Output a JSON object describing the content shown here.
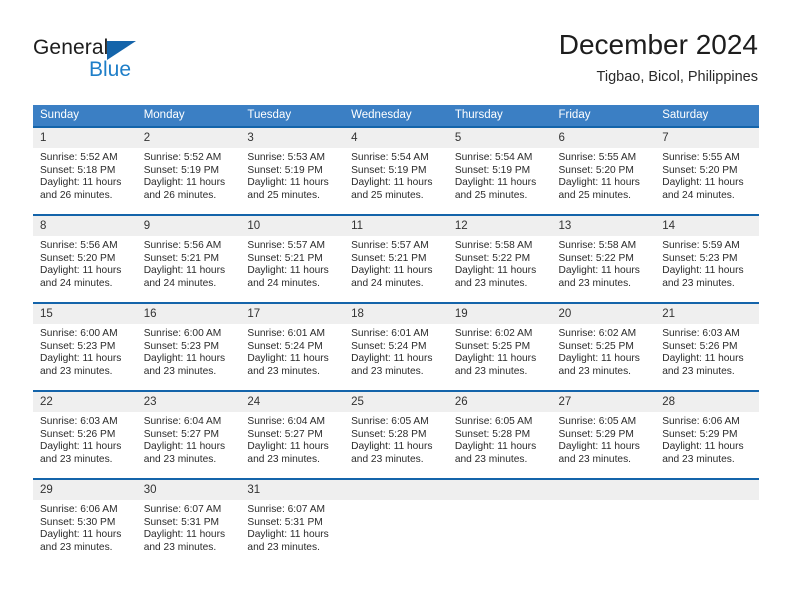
{
  "brand": {
    "name_top": "General",
    "name_bottom": "Blue"
  },
  "header": {
    "title": "December 2024",
    "subtitle": "Tigbao, Bicol, Philippines"
  },
  "colors": {
    "header_blue": "#3b7fc4",
    "border_blue": "#1464aa",
    "daynum_band": "#efefef",
    "logo_blue": "#1e7ec8"
  },
  "calendar": {
    "weekday_headers": [
      "Sunday",
      "Monday",
      "Tuesday",
      "Wednesday",
      "Thursday",
      "Friday",
      "Saturday"
    ],
    "weeks": [
      [
        {
          "day": "1",
          "sunrise": "Sunrise: 5:52 AM",
          "sunset": "Sunset: 5:18 PM",
          "daylight": "Daylight: 11 hours and 26 minutes."
        },
        {
          "day": "2",
          "sunrise": "Sunrise: 5:52 AM",
          "sunset": "Sunset: 5:19 PM",
          "daylight": "Daylight: 11 hours and 26 minutes."
        },
        {
          "day": "3",
          "sunrise": "Sunrise: 5:53 AM",
          "sunset": "Sunset: 5:19 PM",
          "daylight": "Daylight: 11 hours and 25 minutes."
        },
        {
          "day": "4",
          "sunrise": "Sunrise: 5:54 AM",
          "sunset": "Sunset: 5:19 PM",
          "daylight": "Daylight: 11 hours and 25 minutes."
        },
        {
          "day": "5",
          "sunrise": "Sunrise: 5:54 AM",
          "sunset": "Sunset: 5:19 PM",
          "daylight": "Daylight: 11 hours and 25 minutes."
        },
        {
          "day": "6",
          "sunrise": "Sunrise: 5:55 AM",
          "sunset": "Sunset: 5:20 PM",
          "daylight": "Daylight: 11 hours and 25 minutes."
        },
        {
          "day": "7",
          "sunrise": "Sunrise: 5:55 AM",
          "sunset": "Sunset: 5:20 PM",
          "daylight": "Daylight: 11 hours and 24 minutes."
        }
      ],
      [
        {
          "day": "8",
          "sunrise": "Sunrise: 5:56 AM",
          "sunset": "Sunset: 5:20 PM",
          "daylight": "Daylight: 11 hours and 24 minutes."
        },
        {
          "day": "9",
          "sunrise": "Sunrise: 5:56 AM",
          "sunset": "Sunset: 5:21 PM",
          "daylight": "Daylight: 11 hours and 24 minutes."
        },
        {
          "day": "10",
          "sunrise": "Sunrise: 5:57 AM",
          "sunset": "Sunset: 5:21 PM",
          "daylight": "Daylight: 11 hours and 24 minutes."
        },
        {
          "day": "11",
          "sunrise": "Sunrise: 5:57 AM",
          "sunset": "Sunset: 5:21 PM",
          "daylight": "Daylight: 11 hours and 24 minutes."
        },
        {
          "day": "12",
          "sunrise": "Sunrise: 5:58 AM",
          "sunset": "Sunset: 5:22 PM",
          "daylight": "Daylight: 11 hours and 23 minutes."
        },
        {
          "day": "13",
          "sunrise": "Sunrise: 5:58 AM",
          "sunset": "Sunset: 5:22 PM",
          "daylight": "Daylight: 11 hours and 23 minutes."
        },
        {
          "day": "14",
          "sunrise": "Sunrise: 5:59 AM",
          "sunset": "Sunset: 5:23 PM",
          "daylight": "Daylight: 11 hours and 23 minutes."
        }
      ],
      [
        {
          "day": "15",
          "sunrise": "Sunrise: 6:00 AM",
          "sunset": "Sunset: 5:23 PM",
          "daylight": "Daylight: 11 hours and 23 minutes."
        },
        {
          "day": "16",
          "sunrise": "Sunrise: 6:00 AM",
          "sunset": "Sunset: 5:23 PM",
          "daylight": "Daylight: 11 hours and 23 minutes."
        },
        {
          "day": "17",
          "sunrise": "Sunrise: 6:01 AM",
          "sunset": "Sunset: 5:24 PM",
          "daylight": "Daylight: 11 hours and 23 minutes."
        },
        {
          "day": "18",
          "sunrise": "Sunrise: 6:01 AM",
          "sunset": "Sunset: 5:24 PM",
          "daylight": "Daylight: 11 hours and 23 minutes."
        },
        {
          "day": "19",
          "sunrise": "Sunrise: 6:02 AM",
          "sunset": "Sunset: 5:25 PM",
          "daylight": "Daylight: 11 hours and 23 minutes."
        },
        {
          "day": "20",
          "sunrise": "Sunrise: 6:02 AM",
          "sunset": "Sunset: 5:25 PM",
          "daylight": "Daylight: 11 hours and 23 minutes."
        },
        {
          "day": "21",
          "sunrise": "Sunrise: 6:03 AM",
          "sunset": "Sunset: 5:26 PM",
          "daylight": "Daylight: 11 hours and 23 minutes."
        }
      ],
      [
        {
          "day": "22",
          "sunrise": "Sunrise: 6:03 AM",
          "sunset": "Sunset: 5:26 PM",
          "daylight": "Daylight: 11 hours and 23 minutes."
        },
        {
          "day": "23",
          "sunrise": "Sunrise: 6:04 AM",
          "sunset": "Sunset: 5:27 PM",
          "daylight": "Daylight: 11 hours and 23 minutes."
        },
        {
          "day": "24",
          "sunrise": "Sunrise: 6:04 AM",
          "sunset": "Sunset: 5:27 PM",
          "daylight": "Daylight: 11 hours and 23 minutes."
        },
        {
          "day": "25",
          "sunrise": "Sunrise: 6:05 AM",
          "sunset": "Sunset: 5:28 PM",
          "daylight": "Daylight: 11 hours and 23 minutes."
        },
        {
          "day": "26",
          "sunrise": "Sunrise: 6:05 AM",
          "sunset": "Sunset: 5:28 PM",
          "daylight": "Daylight: 11 hours and 23 minutes."
        },
        {
          "day": "27",
          "sunrise": "Sunrise: 6:05 AM",
          "sunset": "Sunset: 5:29 PM",
          "daylight": "Daylight: 11 hours and 23 minutes."
        },
        {
          "day": "28",
          "sunrise": "Sunrise: 6:06 AM",
          "sunset": "Sunset: 5:29 PM",
          "daylight": "Daylight: 11 hours and 23 minutes."
        }
      ],
      [
        {
          "day": "29",
          "sunrise": "Sunrise: 6:06 AM",
          "sunset": "Sunset: 5:30 PM",
          "daylight": "Daylight: 11 hours and 23 minutes."
        },
        {
          "day": "30",
          "sunrise": "Sunrise: 6:07 AM",
          "sunset": "Sunset: 5:31 PM",
          "daylight": "Daylight: 11 hours and 23 minutes."
        },
        {
          "day": "31",
          "sunrise": "Sunrise: 6:07 AM",
          "sunset": "Sunset: 5:31 PM",
          "daylight": "Daylight: 11 hours and 23 minutes."
        },
        {
          "day": "",
          "sunrise": "",
          "sunset": "",
          "daylight": ""
        },
        {
          "day": "",
          "sunrise": "",
          "sunset": "",
          "daylight": ""
        },
        {
          "day": "",
          "sunrise": "",
          "sunset": "",
          "daylight": ""
        },
        {
          "day": "",
          "sunrise": "",
          "sunset": "",
          "daylight": ""
        }
      ]
    ]
  }
}
